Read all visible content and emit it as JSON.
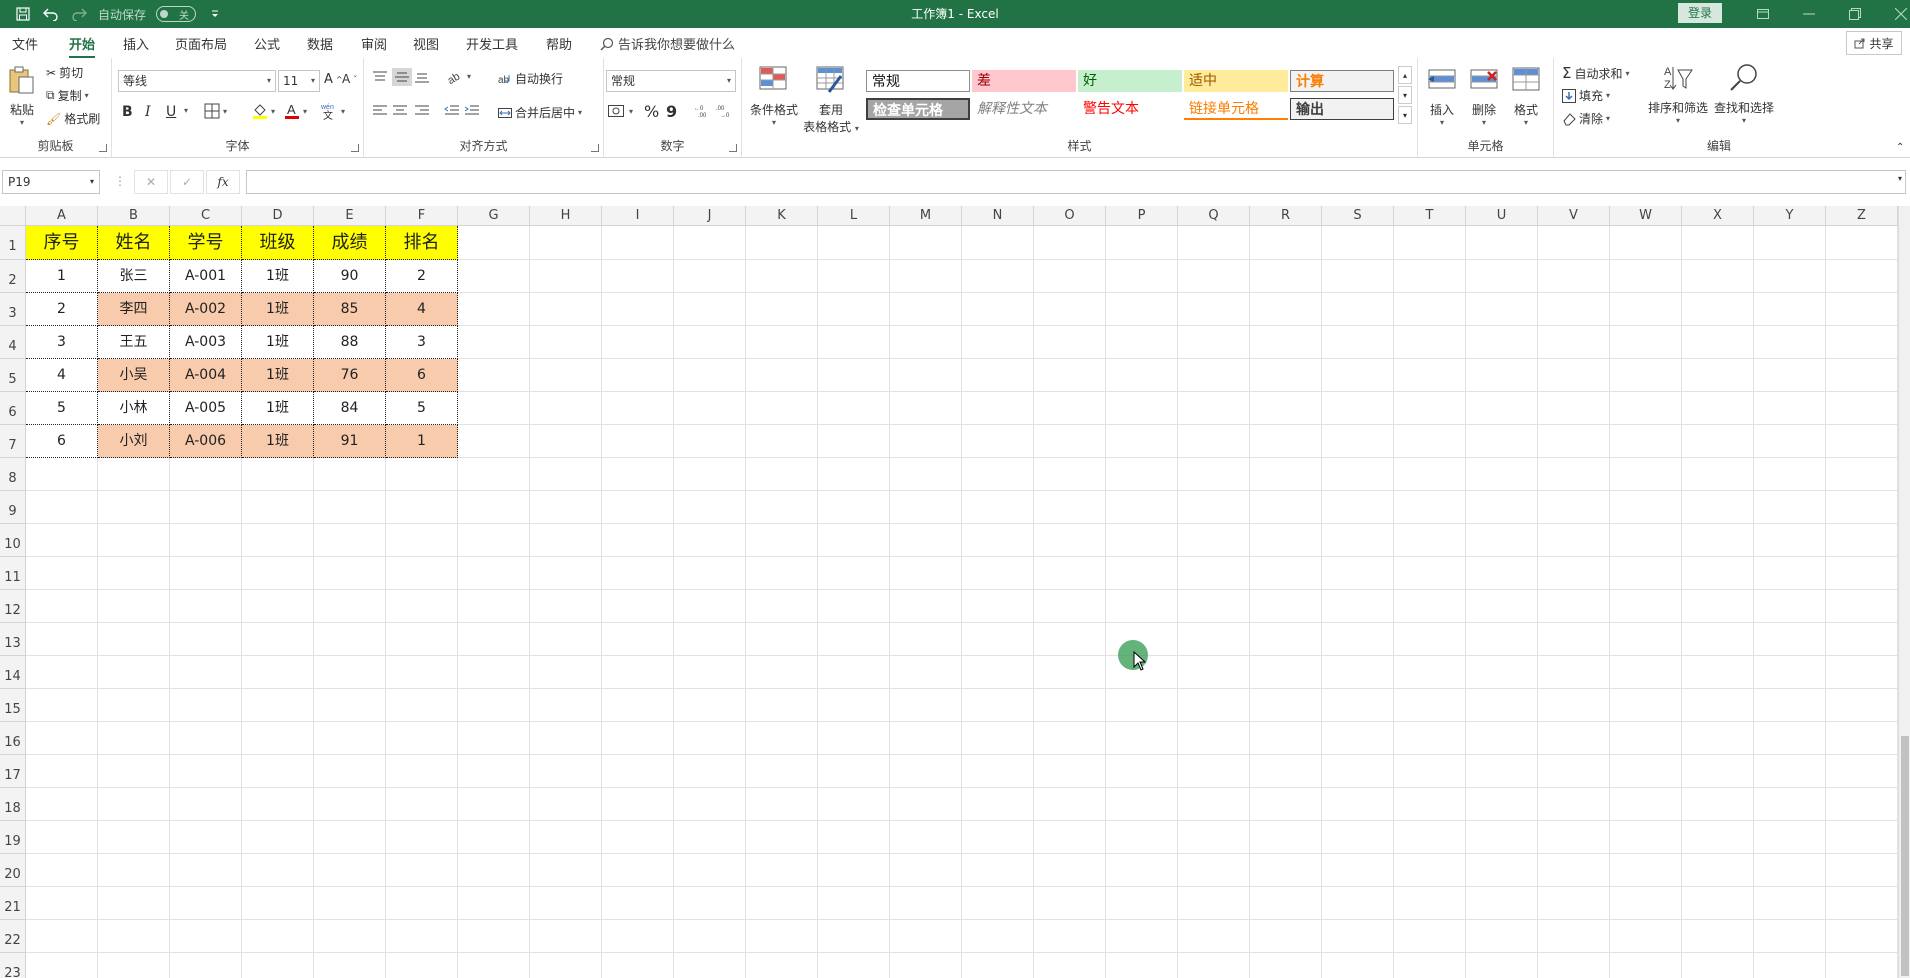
{
  "titlebar": {
    "autosave_label": "自动保存",
    "autosave_state": "关",
    "title": "工作簿1  -  Excel",
    "login": "登录"
  },
  "menu": {
    "tabs": [
      "文件",
      "开始",
      "插入",
      "页面布局",
      "公式",
      "数据",
      "审阅",
      "视图",
      "开发工具",
      "帮助"
    ],
    "active": "开始",
    "tellme": "告诉我你想要做什么",
    "share": "共享"
  },
  "ribbon": {
    "clipboard": {
      "label": "剪贴板",
      "paste": "粘贴",
      "cut": "剪切",
      "copy": "复制",
      "format_painter": "格式刷"
    },
    "font": {
      "label": "字体",
      "font_name": "等线",
      "font_size": "11",
      "bold": "B",
      "italic": "I",
      "underline": "U"
    },
    "alignment": {
      "label": "对齐方式",
      "wrap_text": "自动换行",
      "merge_center": "合并后居中"
    },
    "number": {
      "label": "数字",
      "format": "常规",
      "percent": "%",
      "comma": "9"
    },
    "styles": {
      "label": "样式",
      "conditional": "条件格式",
      "table_line1": "套用",
      "table_line2": "表格格式",
      "boxes": [
        {
          "text": "常规"
        },
        {
          "text": "差"
        },
        {
          "text": "好"
        },
        {
          "text": "适中"
        },
        {
          "text": "计算"
        },
        {
          "text": "检查单元格"
        },
        {
          "text": "解释性文本"
        },
        {
          "text": "警告文本"
        },
        {
          "text": "链接单元格"
        },
        {
          "text": "输出"
        }
      ]
    },
    "cells": {
      "label": "单元格",
      "insert": "插入",
      "delete": "删除",
      "format": "格式"
    },
    "editing": {
      "label": "编辑",
      "autosum": "自动求和",
      "fill": "填充",
      "clear": "清除",
      "sort_filter": "排序和筛选",
      "find_select": "查找和选择"
    }
  },
  "formula": {
    "name_box": "P19",
    "fx": "fx",
    "content": ""
  },
  "sheet": {
    "columns": [
      "A",
      "B",
      "C",
      "D",
      "E",
      "F",
      "G",
      "H",
      "I",
      "J",
      "K",
      "L",
      "M",
      "N",
      "O",
      "P",
      "Q",
      "R",
      "S",
      "T",
      "U",
      "V",
      "W",
      "X",
      "Y",
      "Z"
    ],
    "rows": [
      "1",
      "2",
      "3",
      "4",
      "5",
      "6",
      "7",
      "8",
      "9",
      "10",
      "11",
      "12",
      "13",
      "14",
      "15",
      "16",
      "17",
      "18",
      "19",
      "20",
      "21",
      "22",
      "23"
    ],
    "table_header": [
      "序号",
      "姓名",
      "学号",
      "班级",
      "成绩",
      "排名"
    ],
    "table_rows": [
      [
        "1",
        "张三",
        "A-001",
        "1班",
        "90",
        "2"
      ],
      [
        "2",
        "李四",
        "A-002",
        "1班",
        "85",
        "4"
      ],
      [
        "3",
        "王五",
        "A-003",
        "1班",
        "88",
        "3"
      ],
      [
        "4",
        "小吴",
        "A-004",
        "1班",
        "76",
        "6"
      ],
      [
        "5",
        "小林",
        "A-005",
        "1班",
        "84",
        "5"
      ],
      [
        "6",
        "小刘",
        "A-006",
        "1班",
        "91",
        "1"
      ]
    ]
  },
  "colors": {
    "brand": "#217346",
    "header_fill": "#ffff00",
    "alt_row_fill": "#f8cbad"
  }
}
